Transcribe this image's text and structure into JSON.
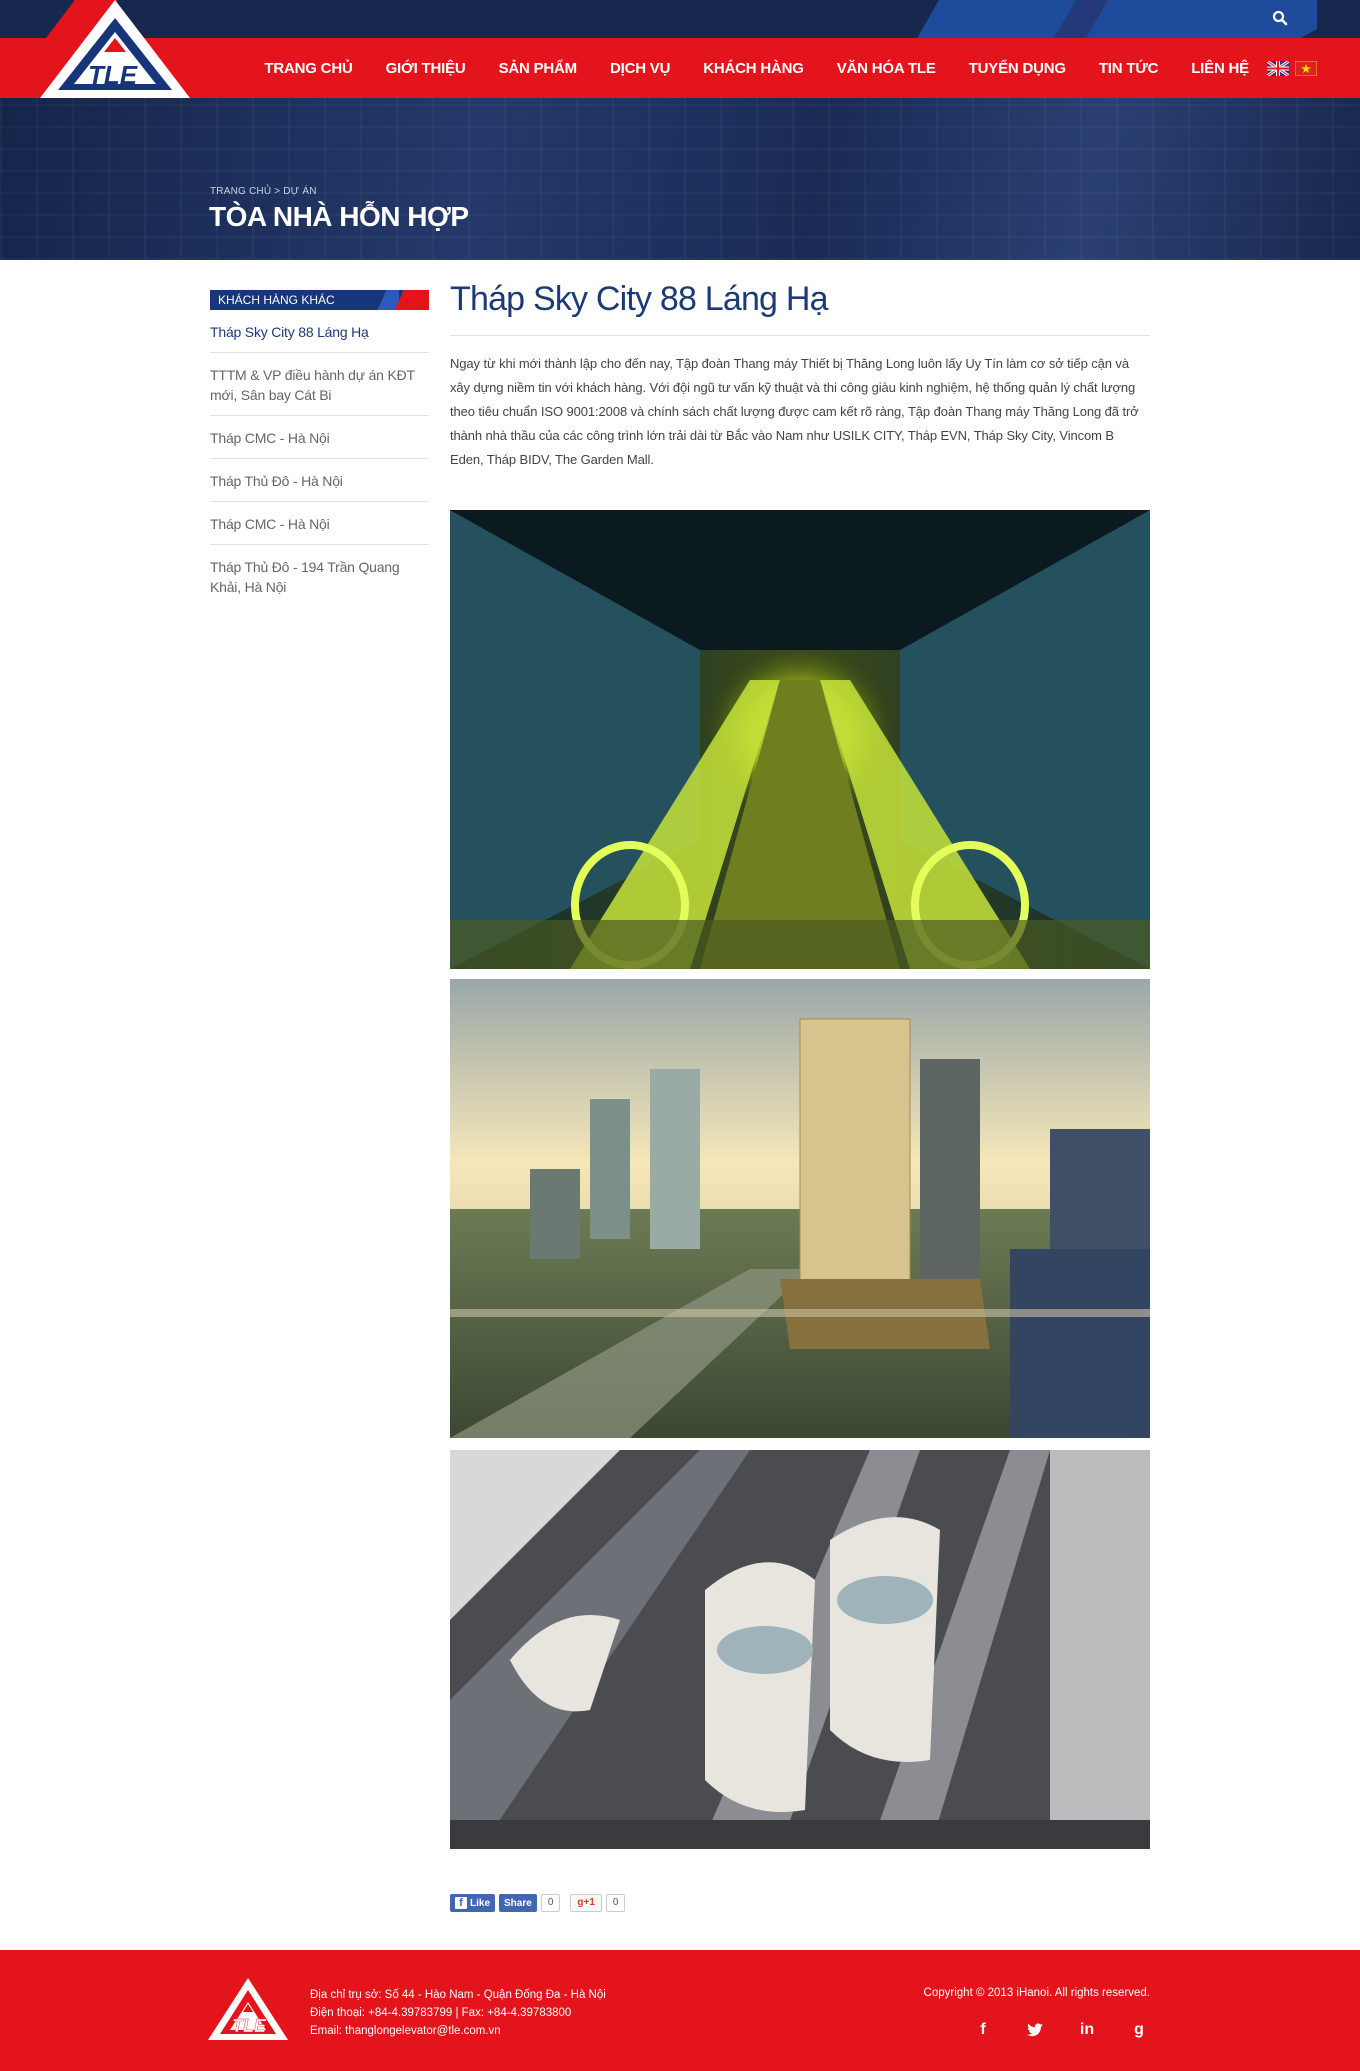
{
  "header": {
    "nav": [
      {
        "label": "TRANG CHỦ"
      },
      {
        "label": "GIỚI THIỆU"
      },
      {
        "label": "SẢN PHẨM"
      },
      {
        "label": "DỊCH VỤ"
      },
      {
        "label": "KHÁCH HÀNG"
      },
      {
        "label": "VĂN HÓA TLE"
      },
      {
        "label": "TUYỂN DỤNG"
      },
      {
        "label": "TIN TỨC"
      },
      {
        "label": "LIÊN HỆ"
      }
    ],
    "languages": [
      "en",
      "vi"
    ],
    "logo_text": "TLE",
    "colors": {
      "brand_red": "#e3141b",
      "brand_navy": "#17284f",
      "brand_blue": "#1e4b9c"
    }
  },
  "hero": {
    "breadcrumb": {
      "home": "TRANG CHỦ",
      "separator": ">",
      "current": "DỰ ÁN"
    },
    "title": "TÒA NHÀ HỖN HỢP"
  },
  "sidebar": {
    "heading": "KHÁCH HÀNG KHÁC",
    "items": [
      {
        "label": "Tháp Sky City 88 Láng Hạ"
      },
      {
        "label": "TTTM & VP điều hành dự án KĐT mới, Sân bay Cát Bi"
      },
      {
        "label": "Tháp CMC - Hà Nội"
      },
      {
        "label": "Tháp Thủ Đô - Hà Nội"
      },
      {
        "label": "Tháp CMC - Hà Nội"
      },
      {
        "label": "Tháp Thủ Đô - 194 Trần Quang Khải, Hà Nội"
      }
    ]
  },
  "article": {
    "title": "Tháp Sky City 88 Láng Hạ",
    "body": "Ngay từ khi mới thành lập cho đến nay, Tập đoàn Thang máy Thiết bị Thăng Long luôn lấy Uy Tín làm cơ sở tiếp cận và xây dựng niềm tin với khách hàng. Với đội ngũ tư vấn kỹ thuật và thi công giàu kinh nghiệm, hệ thống quản lý chất lượng theo tiêu chuẩn ISO 9001:2008 và chính sách chất lượng được cam kết rõ ràng, Tập đoàn Thang máy Thăng Long đã trở thành nhà thầu của các công trình lớn trải dài từ Bắc vào Nam như USILK CITY, Tháp EVN, Tháp Sky City, Vincom B Eden, Tháp BIDV, The Garden Mall.",
    "photos": [
      "escalator-photo",
      "tower-render-photo",
      "panoramic-elevator-photo"
    ]
  },
  "share": {
    "like_label": "Like",
    "share_label": "Share",
    "fb_count": "0",
    "gplus_label": "+1",
    "gplus_count": "0"
  },
  "footer": {
    "address": "Địa chỉ trụ sở: Số 44 - Hào Nam - Quận Đống Đa - Hà Nội",
    "phone": "Điện thoại:  +84-4.39783799  |  Fax: +84-4.39783800",
    "email": "Email: thanglongelevator@tle.com.vn",
    "copyright": "Copyright © 2013 iHanoi. All rights reserved.",
    "socials": [
      "facebook-icon",
      "twitter-icon",
      "linkedin-icon",
      "google-plus-icon"
    ]
  }
}
